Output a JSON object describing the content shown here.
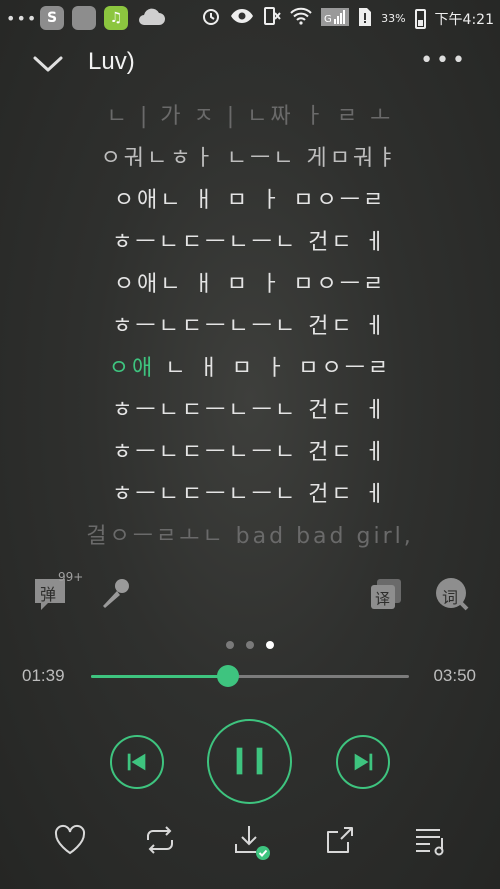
{
  "status_bar": {
    "overflow": "•••",
    "apps": [
      "S",
      "",
      "♫",
      ""
    ],
    "battery_percent": "33%",
    "time": "下午4:21",
    "signal_label": "G"
  },
  "header": {
    "title": "Luv)"
  },
  "lyrics": [
    {
      "text": "ㄴ | 가 ㅈ | ㄴ짜 ㅏ ㄹ ㅗ",
      "state": "faded"
    },
    {
      "text": "ㅇ궈ㄴㅎㅏ ㄴㅡㄴ 게ㅁ궈ㅑ",
      "state": "semi"
    },
    {
      "text": "ㅇ애ㄴ ㅐ ㅁ ㅏ ㅁㅇㅡㄹ",
      "state": "normal"
    },
    {
      "text": "ㅎㅡㄴㄷㅡㄴㅡㄴ 건ㄷ ㅔ",
      "state": "normal"
    },
    {
      "text": "ㅇ애ㄴ ㅐ ㅁ ㅏ ㅁㅇㅡㄹ",
      "state": "normal"
    },
    {
      "text": "ㅎㅡㄴㄷㅡㄴㅡㄴ 건ㄷ ㅔ",
      "state": "normal"
    },
    {
      "text": "",
      "state": "current",
      "sung": "ㅇ애",
      "unsung": "ㄴ ㅐ ㅁ ㅏ ㅁㅇㅡㄹ"
    },
    {
      "text": "ㅎㅡㄴㄷㅡㄴㅡㄴ 건ㄷ ㅔ",
      "state": "normal"
    },
    {
      "text": "ㅎㅡㄴㄷㅡㄴㅡㄴ 건ㄷ ㅔ",
      "state": "normal"
    },
    {
      "text": "ㅎㅡㄴㄷㅡㄴㅡㄴ 건ㄷ ㅔ",
      "state": "normal"
    },
    {
      "text": "걸ㅇㅡㄹㅗㄴ bad bad girl,",
      "state": "faded"
    }
  ],
  "tools": {
    "danmaku_label": "弹",
    "danmaku_count": "99+",
    "translate_label": "译",
    "lyrics_label": "词"
  },
  "pager": {
    "count": 3,
    "active_index": 2
  },
  "progress": {
    "elapsed": "01:39",
    "total": "03:50",
    "fraction": 0.43
  },
  "colors": {
    "accent": "#3ec47f",
    "icon_grey": "#9a9a9a",
    "text": "#e4e4e4"
  },
  "icons": {
    "header": [
      "chevron-down-icon",
      "more-icon"
    ],
    "controls": [
      "previous-icon",
      "pause-icon",
      "next-icon"
    ],
    "bottom": [
      "heart-icon",
      "repeat-icon",
      "download-icon",
      "share-icon",
      "playlist-icon"
    ]
  }
}
